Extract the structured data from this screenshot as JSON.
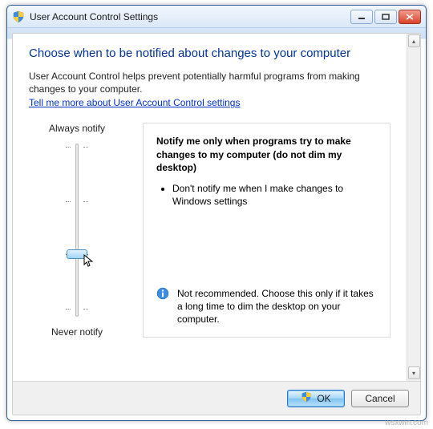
{
  "window": {
    "title": "User Account Control Settings"
  },
  "heading": "Choose when to be notified about changes to your computer",
  "intro": "User Account Control helps prevent potentially harmful programs from making changes to your computer.",
  "help_link": "Tell me more about User Account Control settings",
  "slider": {
    "top_label": "Always notify",
    "bottom_label": "Never notify",
    "levels": 4,
    "selected_index": 2
  },
  "description": {
    "title": "Notify me only when programs try to make changes to my computer (do not dim my desktop)",
    "bullets": [
      "Don't notify me when I make changes to Windows settings"
    ],
    "info": "Not recommended. Choose this only if it takes a long time to dim the desktop on your computer."
  },
  "buttons": {
    "ok": "OK",
    "cancel": "Cancel"
  },
  "watermark": "wsxwin.com"
}
